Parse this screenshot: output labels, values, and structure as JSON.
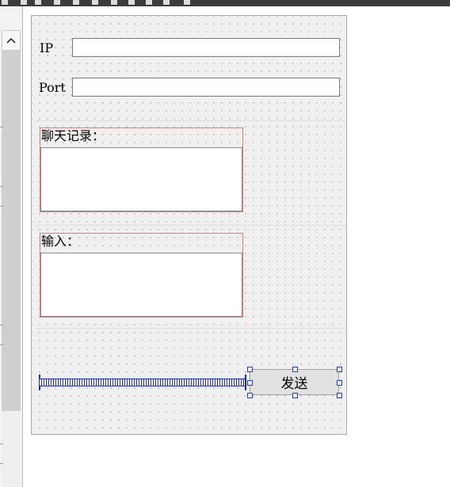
{
  "form": {
    "ip_label": "IP",
    "ip_value": "",
    "port_label": "Port",
    "port_value": "",
    "chat_title": "聊天记录：",
    "chat_text": "",
    "input_title": "输入：",
    "input_text": "",
    "send_label": "发送"
  },
  "colors": {
    "canvas_bg": "#f0f0f0",
    "selection_border": "#e07a7a",
    "spacer": "#1c2ea8",
    "button_bg": "#e1e1e1"
  }
}
